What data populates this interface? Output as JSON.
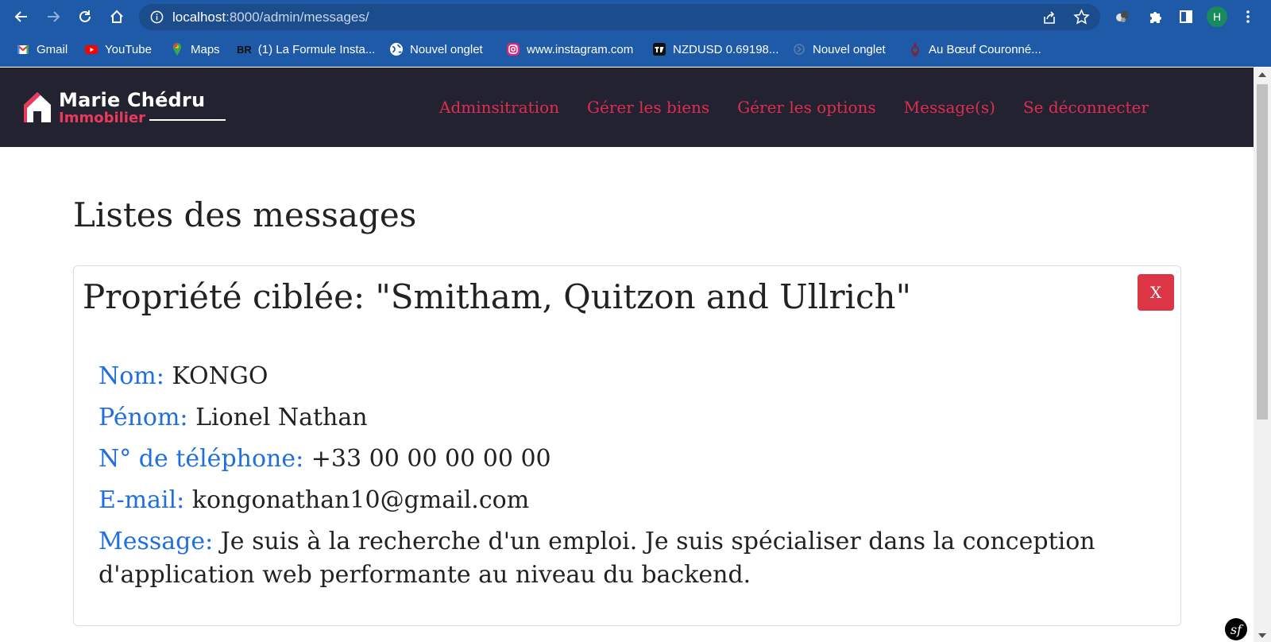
{
  "browser": {
    "url_host": "localhost",
    "url_path": ":8000/admin/messages/",
    "profile_initial": "H",
    "bookmarks": [
      {
        "label": "Gmail",
        "icon": "gmail-icon"
      },
      {
        "label": "YouTube",
        "icon": "youtube-icon"
      },
      {
        "label": "Maps",
        "icon": "maps-icon"
      },
      {
        "label": "(1) La Formule Insta...",
        "icon": "br-icon"
      },
      {
        "label": "Nouvel onglet",
        "icon": "globe-icon"
      },
      {
        "label": "www.instagram.com",
        "icon": "instagram-icon"
      },
      {
        "label": "NZDUSD 0.69198...",
        "icon": "tradingview-icon"
      },
      {
        "label": "Nouvel onglet",
        "icon": "tab-icon"
      },
      {
        "label": "Au Bœuf Couronné...",
        "icon": "restaurant-icon"
      }
    ],
    "bookmark_prefix": "BR"
  },
  "site": {
    "brand_name": "Marie Chédru",
    "brand_sub": "Immobilier",
    "nav": [
      {
        "label": "Adminsitration"
      },
      {
        "label": "Gérer les biens"
      },
      {
        "label": "Gérer les options"
      },
      {
        "label": "Message(s)"
      },
      {
        "label": "Se déconnecter"
      }
    ]
  },
  "page": {
    "title": "Listes des messages",
    "messages": [
      {
        "property_title": "Propriété ciblée: \"Smitham, Quitzon and Ullrich\"",
        "delete_label": "X",
        "nom_label": "Nom:",
        "nom": "KONGO",
        "prenom_label": "Pénom:",
        "prenom": "Lionel Nathan",
        "phone_label": "N° de téléphone:",
        "phone": "+33 00 00 00 00 00",
        "email_label": "E-mail:",
        "email": "kongonathan10@gmail.com",
        "message_label": "Message:",
        "message": "Je suis à la recherche d'un emploi. Je suis spécialiser dans la conception d'application web performante au niveau du backend."
      }
    ]
  },
  "debug_toolbar": {
    "label": "sf"
  },
  "colors": {
    "chrome_bg": "#1e5aa8",
    "header_bg": "#232231",
    "nav_link": "#e02d4f",
    "label_blue": "#1f6fe0",
    "delete_red": "#dc3545"
  }
}
